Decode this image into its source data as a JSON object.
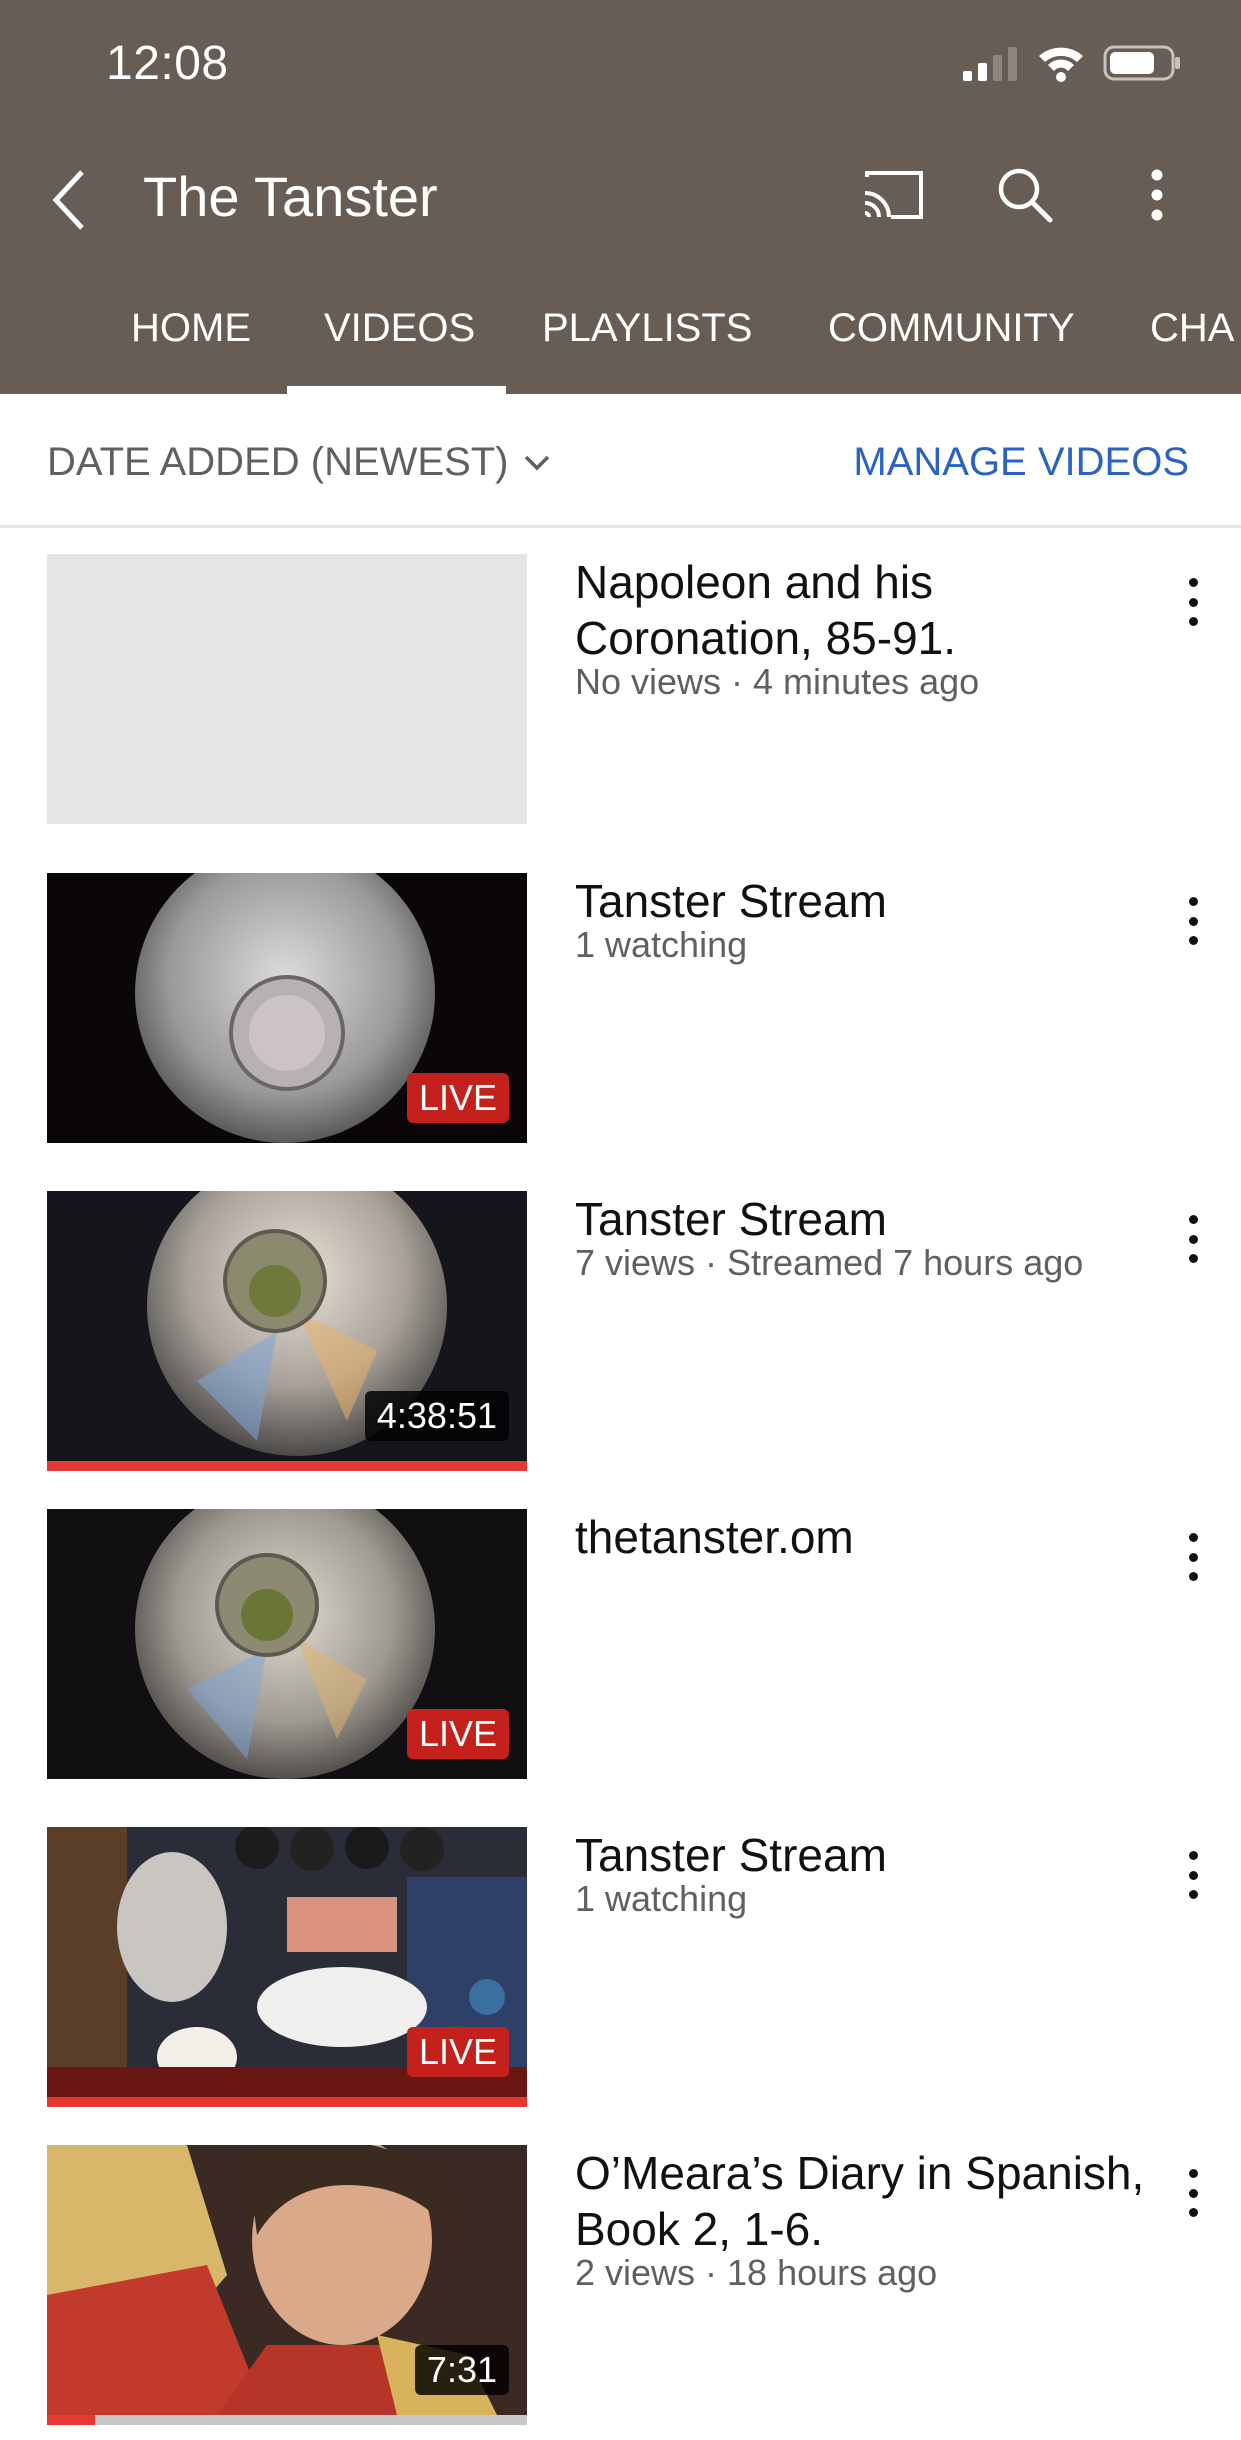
{
  "status_bar": {
    "time": "12:08"
  },
  "header": {
    "channel_name": "The Tanster",
    "icons": [
      "back-arrow-icon",
      "cast-icon",
      "search-icon",
      "more-vert-icon"
    ]
  },
  "tabs": [
    {
      "label": "HOME",
      "selected": false
    },
    {
      "label": "VIDEOS",
      "selected": true
    },
    {
      "label": "PLAYLISTS",
      "selected": false
    },
    {
      "label": "COMMUNITY",
      "selected": false
    },
    {
      "label": "CHA",
      "selected": false
    }
  ],
  "filter": {
    "sort_label": "DATE ADDED (NEWEST)",
    "manage_label": "MANAGE VIDEOS"
  },
  "colors": {
    "appbar": "#675d54",
    "accent_blue": "#2a63c4",
    "live_red": "#c4201c",
    "progress_red": "#e53935"
  },
  "videos": [
    {
      "title": "Napoleon and his Coronation, 85-91.",
      "meta": "No views · 4 minutes ago",
      "badge": "",
      "progress": 0
    },
    {
      "title": "Tanster Stream",
      "meta": "1 watching",
      "badge": "LIVE",
      "progress": 0
    },
    {
      "title": "Tanster Stream",
      "meta": "7 views · Streamed 7 hours ago",
      "badge": "4:38:51",
      "progress": 1.0
    },
    {
      "title": "thetanster.om",
      "meta": "",
      "badge": "LIVE",
      "progress": 0
    },
    {
      "title": "Tanster Stream",
      "meta": "1 watching",
      "badge": "LIVE",
      "progress": 1.0
    },
    {
      "title": "O’Meara’s Diary in Spanish, Book 2, 1-6.",
      "meta": "2 views · 18 hours ago",
      "badge": "7:31",
      "progress": 0.1
    }
  ]
}
